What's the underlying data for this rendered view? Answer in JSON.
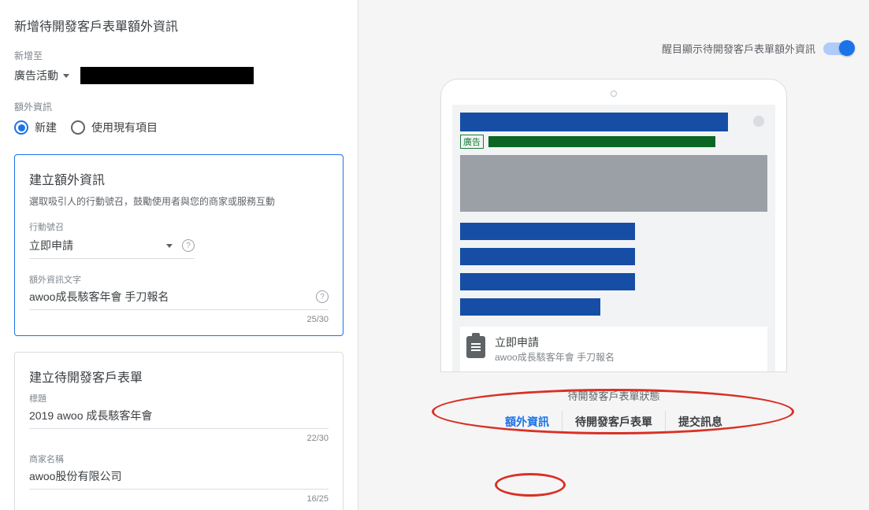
{
  "page_title": "新增待開發客戶表單額外資訊",
  "add_to": {
    "label": "新增至"
  },
  "level_dropdown": {
    "value": "廣告活動"
  },
  "extra_section_label": "額外資訊",
  "radio": {
    "new_label": "新建",
    "existing_label": "使用現有項目",
    "selected": "new"
  },
  "build_extension": {
    "title": "建立額外資訊",
    "subtitle": "選取吸引人的行動號召，鼓勵使用者與您的商家或服務互動",
    "cta_label": "行動號召",
    "cta_value": "立即申請",
    "text_label": "額外資訊文字",
    "text_value": "awoo成長駭客年會 手刀報名",
    "char_count": "25/30"
  },
  "build_form": {
    "title": "建立待開發客戶表單",
    "headline_label": "標題",
    "headline_value": "2019 awoo 成長駭客年會",
    "headline_count": "22/30",
    "business_label": "商家名稱",
    "business_value": "awoo股份有限公司",
    "business_count": "16/25"
  },
  "preview_toggle": {
    "label": "醒目顯示待開發客戶表單額外資訊"
  },
  "preview": {
    "ad_badge": "廣告",
    "cta_main": "立即申請",
    "cta_sub": "awoo成長駭客年會 手刀報名"
  },
  "preview_tabs": {
    "state_label": "待開發客戶表單狀態",
    "t1": "額外資訊",
    "t2": "待開發客戶表單",
    "t3": "提交訊息"
  }
}
